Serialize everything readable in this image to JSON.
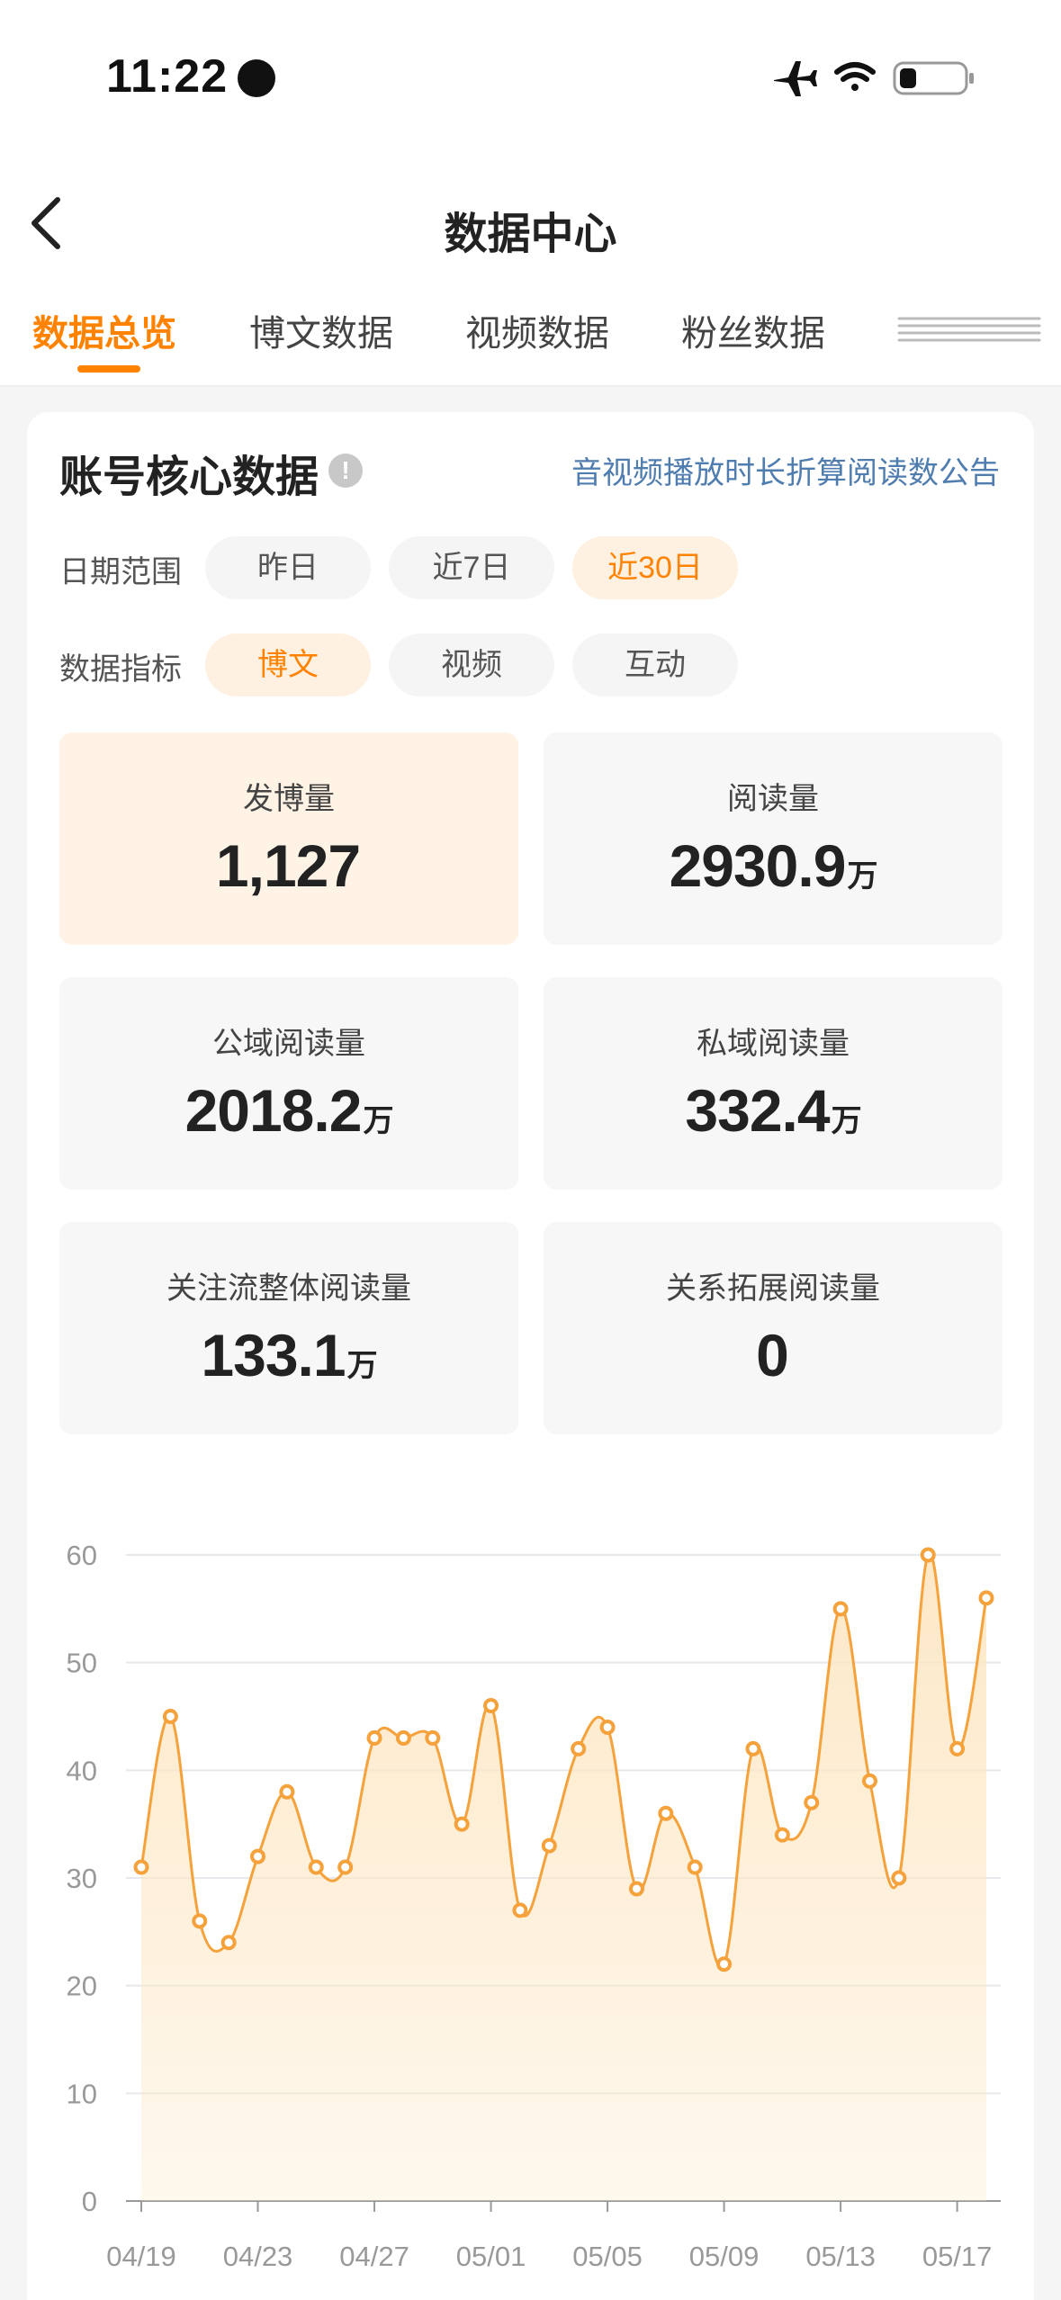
{
  "status_bar": {
    "time": "11:22"
  },
  "nav": {
    "title": "数据中心"
  },
  "tabs": [
    {
      "label": "数据总览",
      "active": true
    },
    {
      "label": "博文数据",
      "active": false
    },
    {
      "label": "视频数据",
      "active": false
    },
    {
      "label": "粉丝数据",
      "active": false
    }
  ],
  "card": {
    "title": "账号核心数据",
    "info_icon": "!",
    "notice_link": "音视频播放时长折算阅读数公告",
    "date_range": {
      "label": "日期范围",
      "options": [
        "昨日",
        "近7日",
        "近30日"
      ],
      "selected": "近30日"
    },
    "metric_type": {
      "label": "数据指标",
      "options": [
        "博文",
        "视频",
        "互动"
      ],
      "selected": "博文"
    },
    "metrics": [
      {
        "label": "发博量",
        "value": "1,127",
        "unit": ""
      },
      {
        "label": "阅读量",
        "value": "2930.9",
        "unit": "万"
      },
      {
        "label": "公域阅读量",
        "value": "2018.2",
        "unit": "万"
      },
      {
        "label": "私域阅读量",
        "value": "332.4",
        "unit": "万"
      },
      {
        "label": "关注流整体阅读量",
        "value": "133.1",
        "unit": "万"
      },
      {
        "label": "关系拓展阅读量",
        "value": "0",
        "unit": ""
      }
    ]
  },
  "colors": {
    "accent": "#ff8200",
    "link": "#507daf",
    "line": "#f5a23c",
    "area": "#fde7c4"
  },
  "chart_data": {
    "type": "area",
    "x": [
      "04/19",
      "04/20",
      "04/21",
      "04/22",
      "04/23",
      "04/24",
      "04/25",
      "04/26",
      "04/27",
      "04/28",
      "04/29",
      "04/30",
      "05/01",
      "05/02",
      "05/03",
      "05/04",
      "05/05",
      "05/06",
      "05/07",
      "05/08",
      "05/09",
      "05/10",
      "05/11",
      "05/12",
      "05/13",
      "05/14",
      "05/15",
      "05/16",
      "05/17",
      "05/18"
    ],
    "values": [
      31,
      45,
      26,
      24,
      32,
      38,
      31,
      31,
      43,
      43,
      43,
      35,
      46,
      27,
      33,
      42,
      44,
      29,
      36,
      31,
      22,
      42,
      34,
      37,
      55,
      39,
      30,
      60,
      42,
      56
    ],
    "x_tick_labels": [
      "04/19",
      "04/23",
      "04/27",
      "05/01",
      "05/05",
      "05/09",
      "05/13",
      "05/17"
    ],
    "y_ticks": [
      0,
      10,
      20,
      30,
      40,
      50,
      60
    ],
    "ylim": [
      0,
      60
    ],
    "grid": true
  }
}
